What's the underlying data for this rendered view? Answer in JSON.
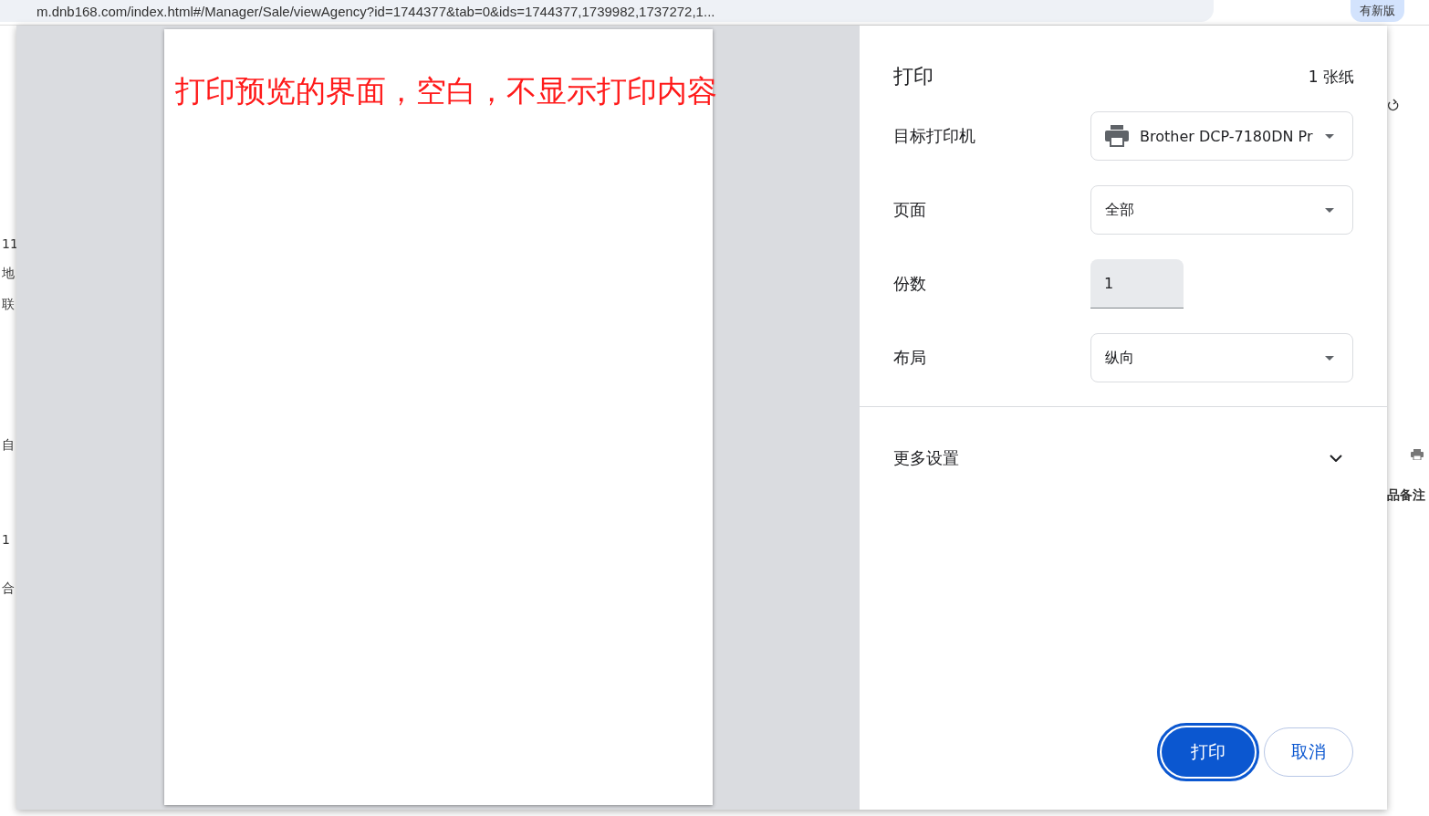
{
  "browser": {
    "url": "m.dnb168.com/index.html#/Manager/Sale/viewAgency?id=1744377&tab=0&ids=1744377,1739982,1737272,1...",
    "update_button": "有新版"
  },
  "background_page": {
    "left_fragments": [
      "11",
      "地",
      "联",
      "自",
      "1",
      "合"
    ],
    "right_fragments": [
      "品备注"
    ]
  },
  "print_dialog": {
    "preview_note": "打印预览的界面，空白，不显示打印内容",
    "title": "打印",
    "sheet_count": "1 张纸",
    "settings": [
      {
        "kind": "printer",
        "label": "目标打印机",
        "value": "Brother DCP-7180DN Pr"
      },
      {
        "kind": "select",
        "label": "页面",
        "value": "全部"
      },
      {
        "kind": "number",
        "label": "份数",
        "value": "1"
      },
      {
        "kind": "select",
        "label": "布局",
        "value": "纵向"
      }
    ],
    "more_settings": {
      "label": "更多设置",
      "expanded": false
    },
    "buttons": [
      {
        "kind": "primary",
        "label": "打印",
        "focused": true
      },
      {
        "kind": "secondary",
        "label": "取消",
        "focused": false
      }
    ]
  }
}
